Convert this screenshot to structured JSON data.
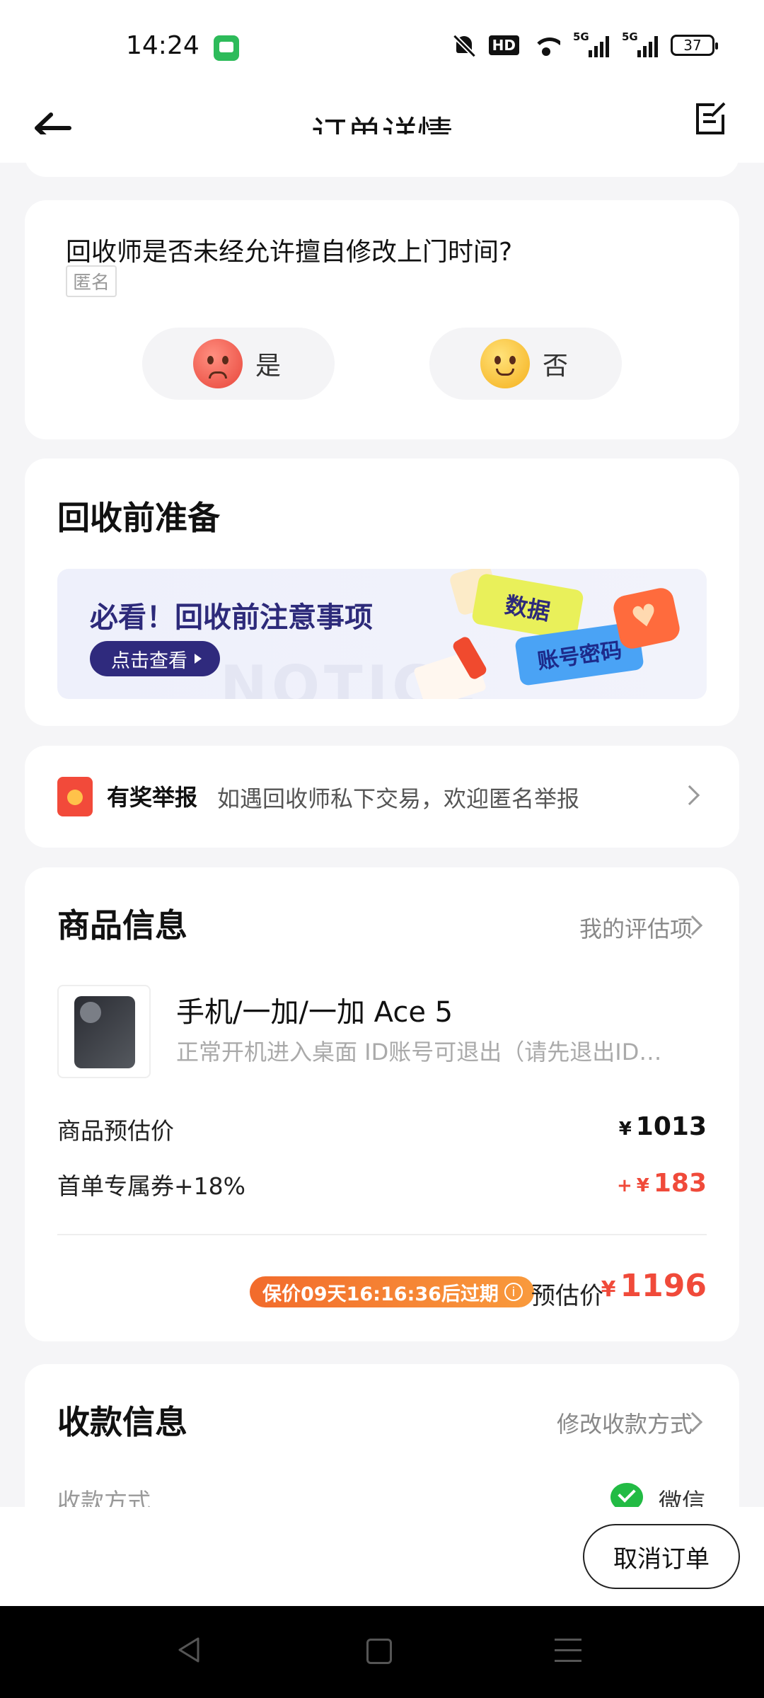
{
  "status": {
    "time": "14:24",
    "battery": "37",
    "hd": "HD",
    "network": "5G"
  },
  "header": {
    "title": "订单详情"
  },
  "survey": {
    "question": "回收师是否未经允许擅自修改上门时间?",
    "anonymous_tag": "匿名",
    "options": [
      {
        "label": "是",
        "icon": "angry-face-icon"
      },
      {
        "label": "否",
        "icon": "smile-face-icon"
      }
    ]
  },
  "prep": {
    "title": "回收前准备",
    "banner_title": "必看！回收前注意事项",
    "banner_button": "点击查看",
    "banner_tag_data": "数据",
    "banner_tag_password": "账号密码",
    "banner_watermark": "NOTICE"
  },
  "report": {
    "title": "有奖举报",
    "desc": "如遇回收师私下交易，欢迎匿名举报"
  },
  "product": {
    "section_title": "商品信息",
    "my_eval_link": "我的评估项",
    "name": "手机/一加/一加 Ace 5",
    "desc": "正常开机进入桌面 ID账号可退出（请先退出ID账号）",
    "price_label": "商品预估价",
    "currency": "¥",
    "price_value": "1013",
    "coupon_label": "首单专属券+18%",
    "coupon_prefix": "+",
    "coupon_value": "183",
    "expire_badge": "保价09天16:16:36后过期",
    "est_label": "预估价",
    "est_value": "1196"
  },
  "payment": {
    "section_title": "收款信息",
    "modify_link": "修改收款方式",
    "method_label": "收款方式",
    "method_value": "微信"
  },
  "footer": {
    "cancel_button": "取消订单"
  },
  "colors": {
    "accent_red": "#f04a3a",
    "banner_navy": "#2f2a7d",
    "badge_orange": "#f26b2c"
  }
}
